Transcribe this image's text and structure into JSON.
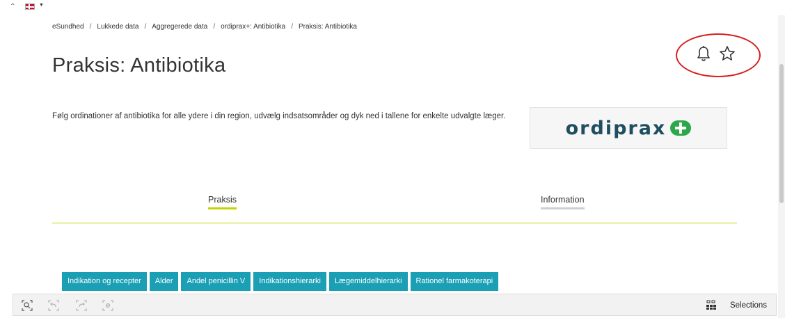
{
  "breadcrumb": {
    "items": [
      "eSundhed",
      "Lukkede data",
      "Aggregerede data",
      "ordiprax+: Antibiotika",
      "Praksis: Antibiotika"
    ],
    "separator": "/"
  },
  "page": {
    "title": "Praksis: Antibiotika",
    "description": "Følg ordinationer af antibiotika for alle ydere i din region, udvælg indsatsområder og dyk ned i tallene for enkelte udvalgte læger."
  },
  "header_icons": [
    "bell-icon",
    "star-icon"
  ],
  "logo": {
    "text": "ordiprax",
    "mark": "plus-icon",
    "text_color": "#1f4e5f",
    "mark_color": "#2aa84a"
  },
  "tabs": {
    "praksis": "Praksis",
    "information": "Information",
    "active": "Praksis"
  },
  "sheet_tabs": [
    "Indikation og recepter",
    "Alder",
    "Andel penicillin V",
    "Indikationshierarki",
    "Lægemiddelhierarki",
    "Rationel farmakoterapi"
  ],
  "toolbar": {
    "icons": [
      "smart-search-icon",
      "step-back-icon",
      "step-forward-icon",
      "clear-selections-icon"
    ],
    "selections_label": "Selections"
  },
  "colors": {
    "accent": "#c5d400",
    "sheet_tab": "#1a9fb5",
    "annotation": "#d61f1f"
  }
}
